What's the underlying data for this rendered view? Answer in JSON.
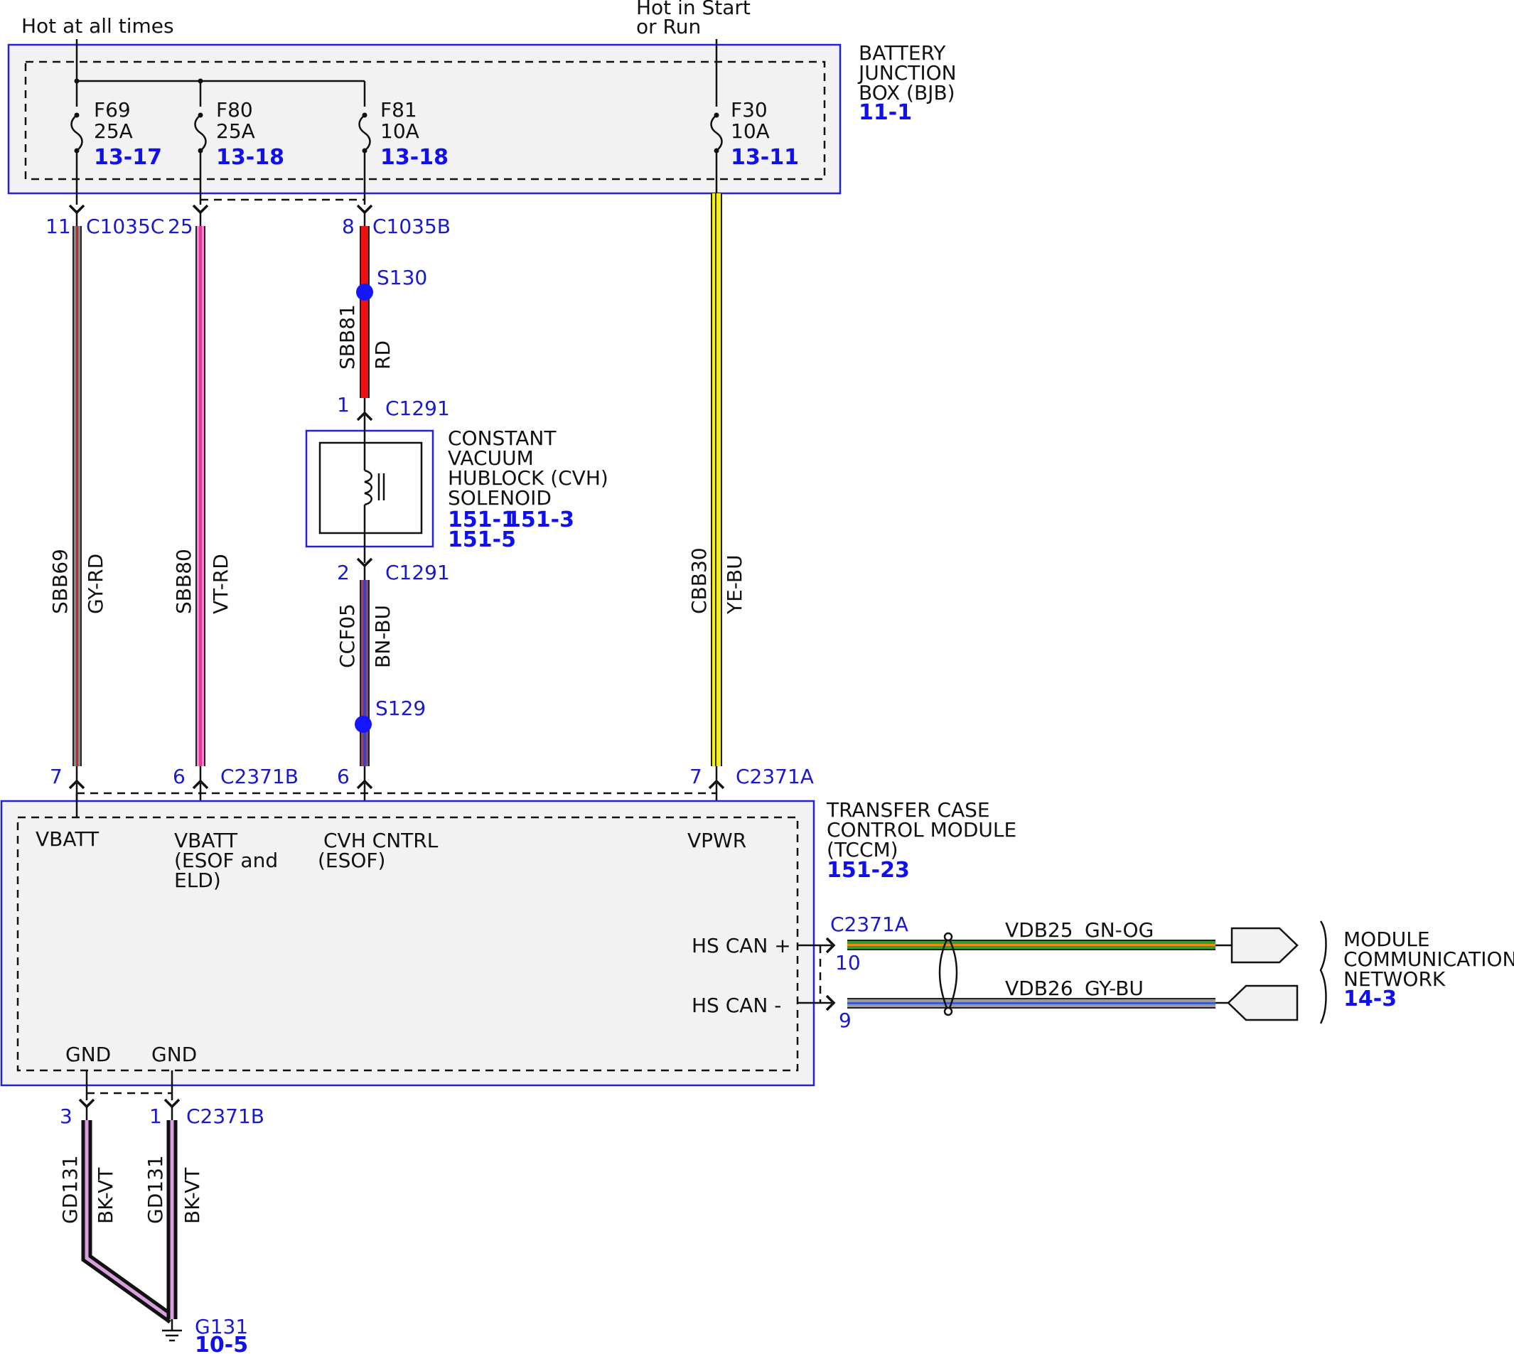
{
  "power": {
    "hot_always": "Hot at all times",
    "hot_start_run_l1": "Hot in Start",
    "hot_start_run_l2": "or Run"
  },
  "bjb": {
    "name_l1": "BATTERY",
    "name_l2": "JUNCTION",
    "name_l3": "BOX (BJB)",
    "ref": "11-1",
    "fuses": [
      {
        "id": "F69",
        "rating": "25A",
        "ref": "13-17"
      },
      {
        "id": "F80",
        "rating": "25A",
        "ref": "13-18"
      },
      {
        "id": "F81",
        "rating": "10A",
        "ref": "13-18"
      },
      {
        "id": "F30",
        "rating": "10A",
        "ref": "13-11"
      }
    ]
  },
  "top_connectors": [
    {
      "pin": "11",
      "name": "C1035C"
    },
    {
      "pin": "25",
      "name": ""
    },
    {
      "pin": "8",
      "name": "C1035B"
    }
  ],
  "splices": {
    "s130": "S130",
    "s129": "S129"
  },
  "wires": {
    "sbb69": {
      "circuit": "SBB69",
      "color": "GY-RD"
    },
    "sbb80": {
      "circuit": "SBB80",
      "color": "VT-RD"
    },
    "sbb81": {
      "circuit": "SBB81",
      "color": "RD"
    },
    "ccf05": {
      "circuit": "CCF05",
      "color": "BN-BU"
    },
    "cbb30": {
      "circuit": "CBB30",
      "color": "YE-BU"
    },
    "vdb25": {
      "circuit": "VDB25",
      "color": "GN-OG"
    },
    "vdb26": {
      "circuit": "VDB26",
      "color": "GY-BU"
    },
    "gd131_a": {
      "circuit": "GD131",
      "color": "BK-VT"
    },
    "gd131_b": {
      "circuit": "GD131",
      "color": "BK-VT"
    }
  },
  "solenoid": {
    "conn_top_pin": "1",
    "conn_top_name": "C1291",
    "conn_bot_pin": "2",
    "conn_bot_name": "C1291",
    "name_l1": "CONSTANT",
    "name_l2": "VACUUM",
    "name_l3": "HUBLOCK (CVH)",
    "name_l4": "SOLENOID",
    "ref1": "151-1",
    "ref2": "151-3",
    "ref3": "151-5"
  },
  "tccm_connectors": [
    {
      "pin": "7",
      "name": ""
    },
    {
      "pin": "6",
      "name": "C2371B"
    },
    {
      "pin": "6",
      "name": ""
    },
    {
      "pin": "7",
      "name": "C2371A"
    }
  ],
  "tccm": {
    "name_l1": "TRANSFER CASE",
    "name_l2": "CONTROL MODULE",
    "name_l3": "(TCCM)",
    "ref": "151-23",
    "pins": {
      "vbatt1": "VBATT",
      "vbatt2_l1": "VBATT",
      "vbatt2_l2": "(ESOF and",
      "vbatt2_l3": "ELD)",
      "cvh_l1": "CVH CNTRL",
      "cvh_l2": "(ESOF)",
      "vpwr": "VPWR",
      "hscan_p": "HS CAN +",
      "hscan_n": "HS CAN -",
      "gnd1": "GND",
      "gnd2": "GND"
    }
  },
  "can": {
    "conn_name": "C2371A",
    "pin_p": "10",
    "pin_n": "9"
  },
  "network": {
    "name_l1": "MODULE",
    "name_l2": "COMMUNICATIONS",
    "name_l3": "NETWORK",
    "ref": "14-3"
  },
  "ground_connectors": [
    {
      "pin": "3",
      "name": ""
    },
    {
      "pin": "1",
      "name": "C2371B"
    }
  ],
  "ground": {
    "name": "G131",
    "ref": "10-5"
  },
  "colors": {
    "box_border": "#2222dd",
    "module_fill": "#f2f2f2",
    "ref_text": "#1010ee",
    "pin_text": "#1a1acc",
    "splice_dot": "#1515ff"
  }
}
